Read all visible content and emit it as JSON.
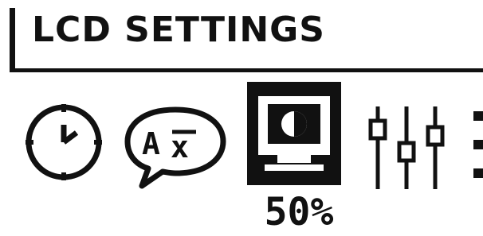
{
  "header": {
    "title": "LCD SETTINGS"
  },
  "menu": {
    "items": [
      {
        "icon": "clock-icon",
        "selected": false
      },
      {
        "icon": "language-icon",
        "selected": false
      },
      {
        "icon": "monitor-contrast-icon",
        "selected": true
      },
      {
        "icon": "equalizer-sliders-icon",
        "selected": false
      },
      {
        "icon": "more-icon",
        "selected": false
      }
    ],
    "selected_value": "50%"
  },
  "colors": {
    "foreground": "#111111",
    "background": "#ffffff"
  }
}
